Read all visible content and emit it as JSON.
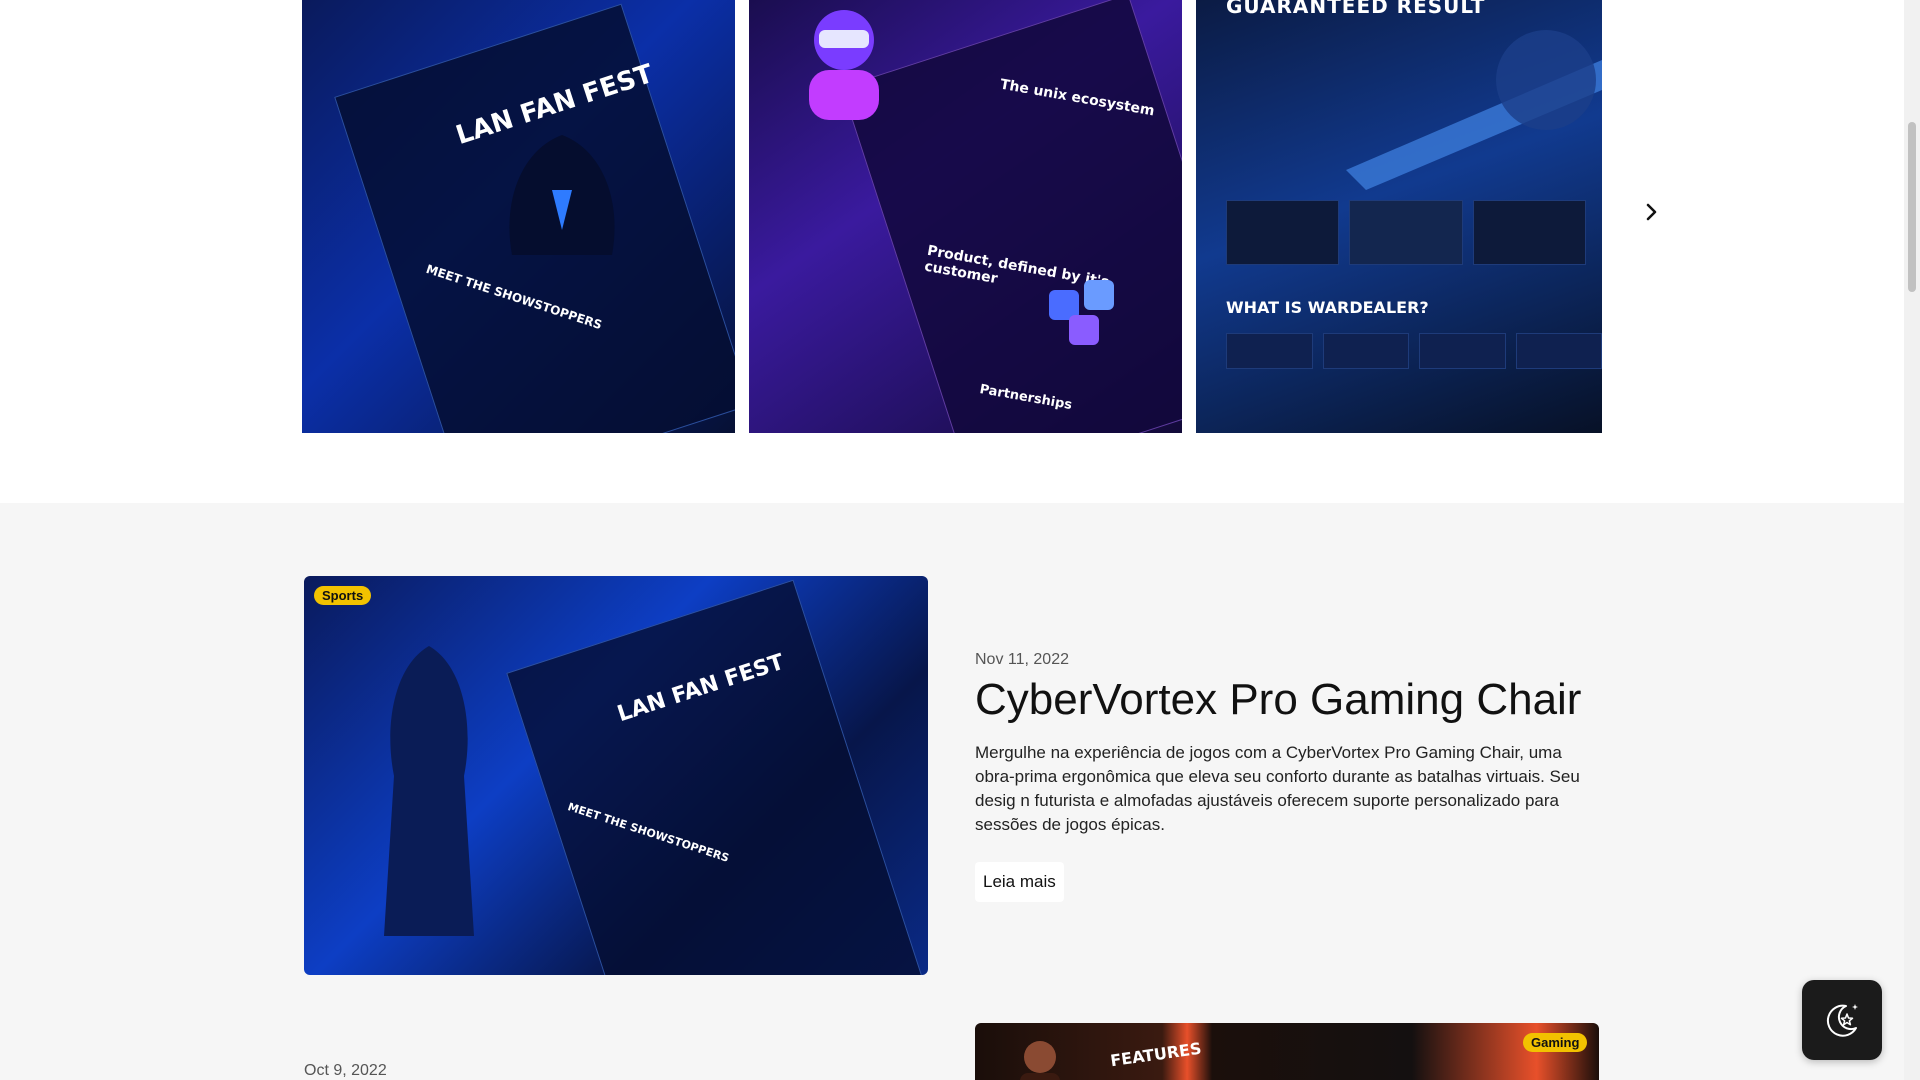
{
  "carousel": {
    "slides": [
      {
        "name": "LAN FAN FEST",
        "headline": "LAN FAN FEST",
        "section": "MEET THE SHOWSTOPPERS"
      },
      {
        "name": "The unix ecosystem",
        "headline": "The unix ecosystem",
        "section": "Product, defined by it's customer",
        "footer": "Partnerships"
      },
      {
        "name": "Wardealer",
        "headline": "GUARANTEED RESULT",
        "section": "WHAT IS WARDEALER?"
      }
    ],
    "next_icon": "chevron-right-icon"
  },
  "post": {
    "badge": "Sports",
    "date": "Nov 11, 2022",
    "title": "CyberVortex Pro Gaming Chair",
    "excerpt": "Mergulhe na experiência de jogos com a CyberVortex Pro Gaming Chair, uma obra-prima ergonômica que eleva seu conforto durante as batalhas virtuais. Seu desig n futurista e almofadas ajustáveis oferecem suporte personalizado para sessões de jogos épicas.",
    "read_more": "Leia mais",
    "image_texts": [
      "LAN FAN FEST",
      "MEET THE SHOWSTOPPERS"
    ]
  },
  "post2": {
    "date": "Oct 9, 2022",
    "badge": "Gaming",
    "image_text": "FEATURES"
  },
  "theme_toggle": {
    "icon": "moon-stars-icon"
  },
  "colors": {
    "accent_blue": "#0d3ec4",
    "badge_yellow": "#f2c200",
    "section_bg": "#f6f6f6",
    "dark_button": "#1b1b1b"
  }
}
